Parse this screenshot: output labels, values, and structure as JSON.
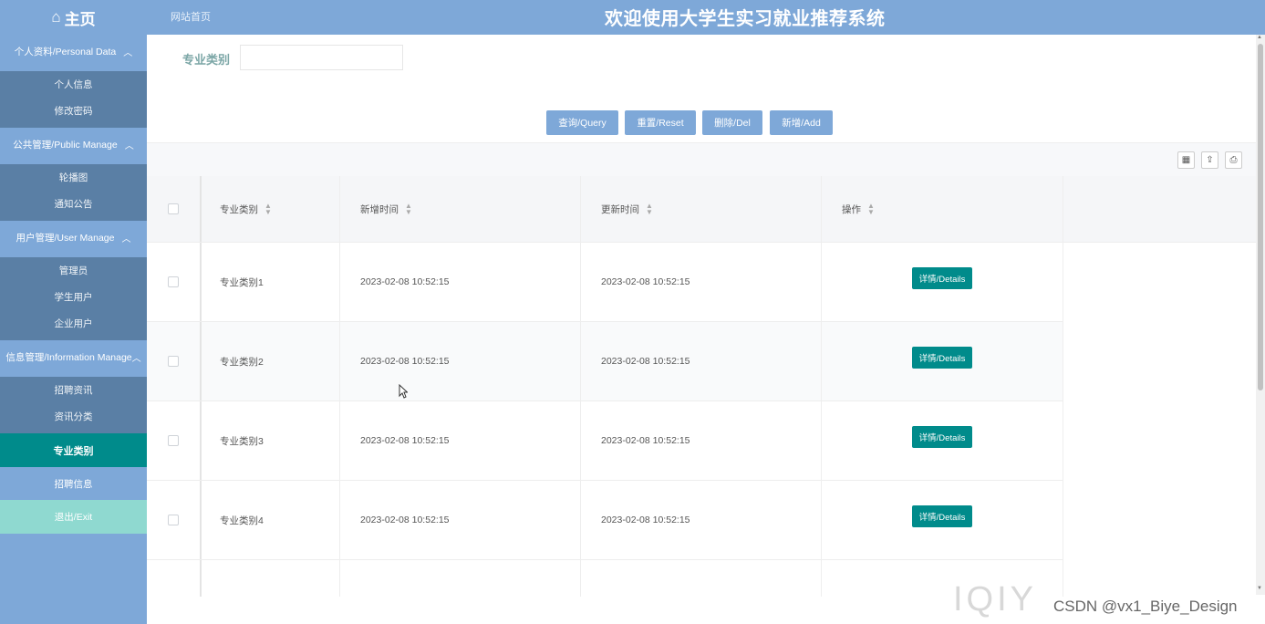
{
  "header": {
    "home_icon": "home-icon",
    "home_label": "主页",
    "breadcrumb": "网站首页",
    "title": "欢迎使用大学生实习就业推荐系统"
  },
  "sidebar": {
    "groups": [
      {
        "label": "个人资料/Personal Data",
        "items": [
          "个人信息",
          "修改密码"
        ]
      },
      {
        "label": "公共管理/Public Manage",
        "items": [
          "轮播图",
          "通知公告"
        ]
      },
      {
        "label": "用户管理/User Manage",
        "items": [
          "管理员",
          "学生用户",
          "企业用户"
        ]
      },
      {
        "label": "信息管理/Information Manage",
        "items": [
          "招聘资讯",
          "资讯分类"
        ]
      }
    ],
    "active_item": "专业类别",
    "plain_item": "招聘信息",
    "exit_label": "退出/Exit"
  },
  "search": {
    "label": "专业类别",
    "value": ""
  },
  "buttons": {
    "query": "查询/Query",
    "reset": "重置/Reset",
    "delete": "删除/Del",
    "add": "新增/Add"
  },
  "table": {
    "columns": [
      "专业类别",
      "新增时间",
      "更新时间",
      "操作"
    ],
    "rows": [
      {
        "category": "专业类别1",
        "created": "2023-02-08 10:52:15",
        "updated": "2023-02-08 10:52:15",
        "action": "详情/Details"
      },
      {
        "category": "专业类别2",
        "created": "2023-02-08 10:52:15",
        "updated": "2023-02-08 10:52:15",
        "action": "详情/Details"
      },
      {
        "category": "专业类别3",
        "created": "2023-02-08 10:52:15",
        "updated": "2023-02-08 10:52:15",
        "action": "详情/Details"
      },
      {
        "category": "专业类别4",
        "created": "2023-02-08 10:52:15",
        "updated": "2023-02-08 10:52:15",
        "action": "详情/Details"
      }
    ]
  },
  "watermark": "CSDN @vx1_Biye_Design",
  "colors": {
    "nav": "#7ea8d8",
    "submenu": "#5a7fa5",
    "accent": "#008b8b",
    "exit": "#8fd9d0"
  }
}
